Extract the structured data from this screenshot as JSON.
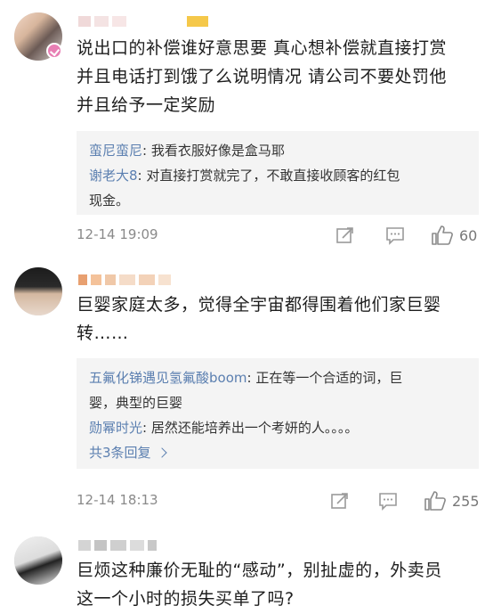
{
  "comments": [
    {
      "text": "说出口的补偿谁好意思要 真心想补偿就直接打赏并且电话打到饿了么说明情况 请公司不要处罚他并且给予一定奖励",
      "lines": [
        "说出口的补偿谁好意思要 真心想补偿就直接打赏",
        "并且电话打到饿了么说明情况 请公司不要处罚他",
        "并且给予一定奖励"
      ],
      "replies": [
        {
          "name": "蛮尼蛮尼",
          "sep": ": ",
          "text": "我看衣服好像是盒马耶"
        },
        {
          "name": "谢老大8",
          "sep": ": ",
          "text": "对直接打赏就完了，不敢直接收顾客的红包",
          "cont": "现金。"
        }
      ],
      "time": "12-14 19:09",
      "likes": "60"
    },
    {
      "lines": [
        "巨婴家庭太多，觉得全宇宙都得围着他们家巨婴",
        "转……"
      ],
      "replies": [
        {
          "name": "五氟化锑遇见氢氟酸boom",
          "sep": ": ",
          "text": "正在等一个合适的词，巨",
          "cont": "婴，典型的巨婴"
        },
        {
          "name": "勋幂时光",
          "sep": ": ",
          "text": "居然还能培养出一个考妍的人。。。。"
        }
      ],
      "more": "共3条回复",
      "time": "12-14 18:13",
      "likes": "255"
    },
    {
      "lines": [
        "巨烦这种廉价无耻的“感动”，别扯虚的，外卖员",
        "这一个小时的损失买单了吗?"
      ]
    }
  ],
  "icons": [
    "share-icon",
    "comment-icon",
    "like-icon"
  ],
  "colors": {
    "reply_name": "#5b7fb0",
    "meta": "#8a8a8a",
    "reply_bg": "#f4f4f4",
    "badge": "#e87fb4"
  }
}
